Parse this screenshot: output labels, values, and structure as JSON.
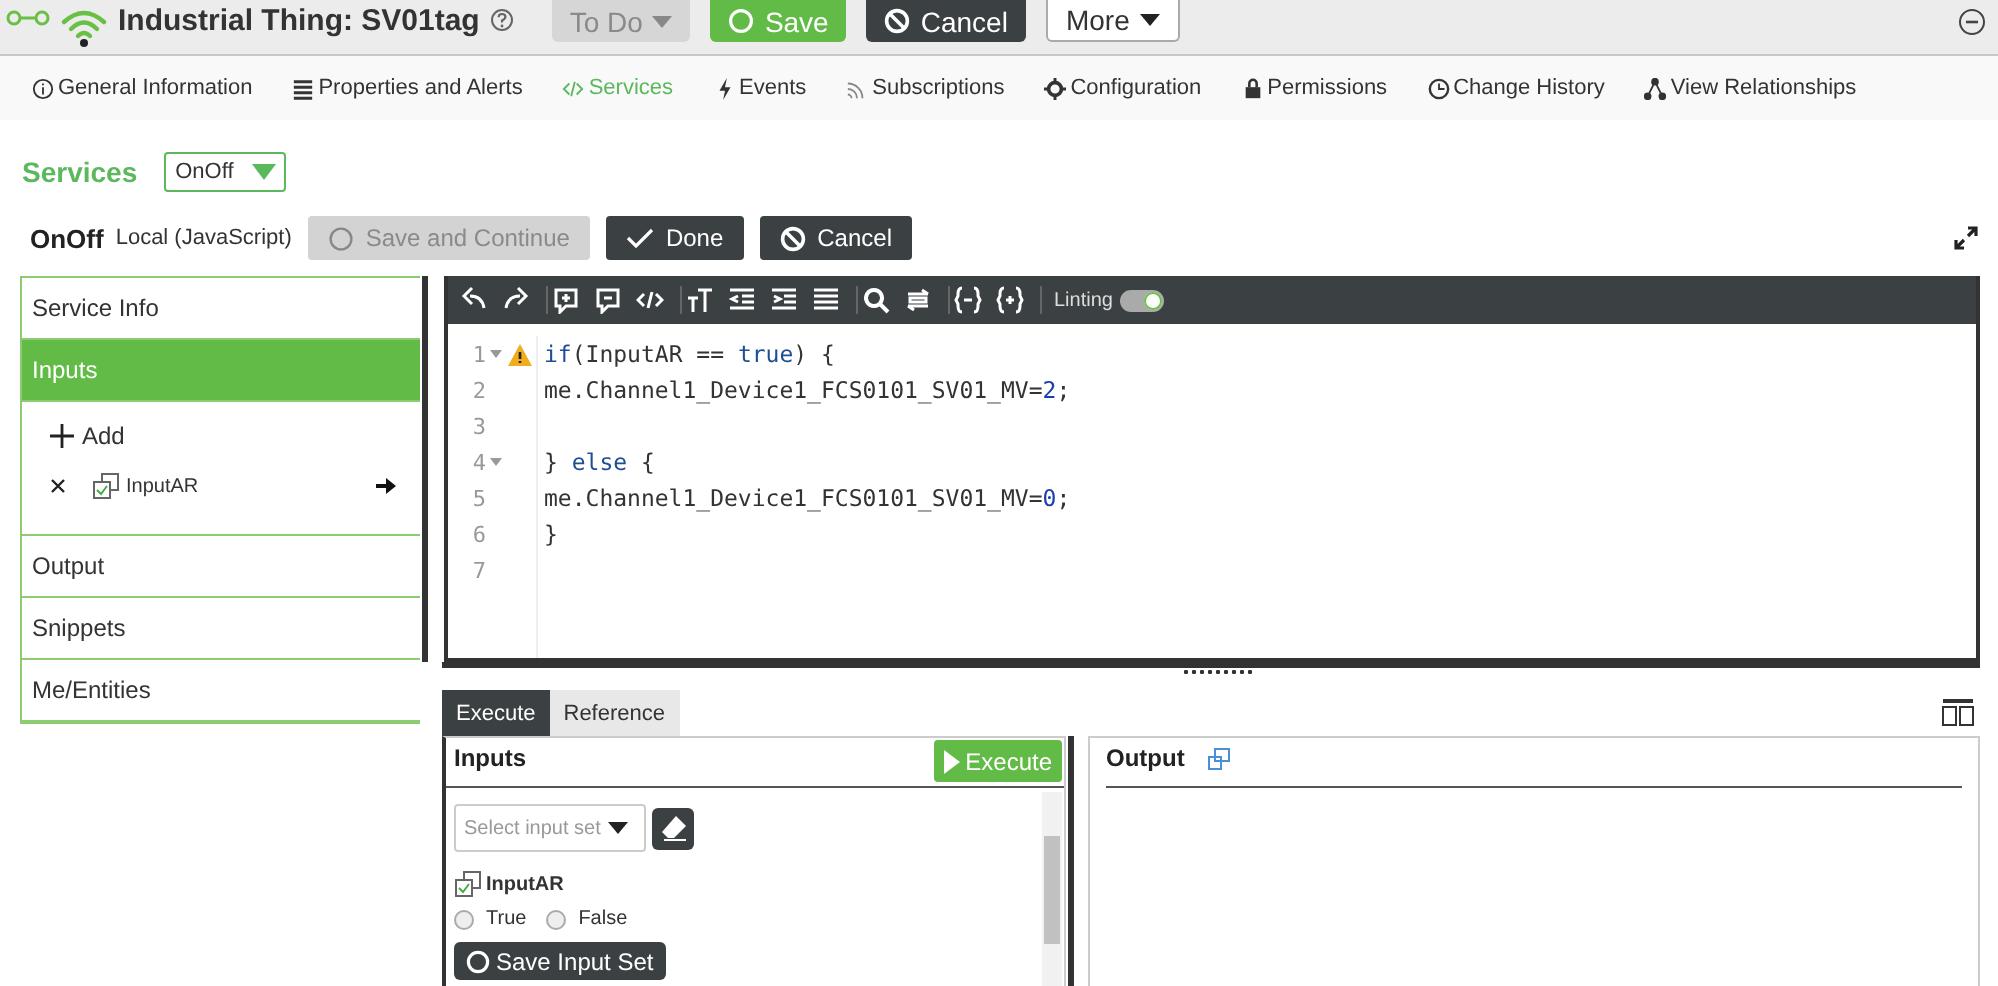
{
  "header": {
    "title": "Industrial Thing: SV01tag",
    "state_button": "To Do",
    "buttons": [
      {
        "label": "Save",
        "kind": "save"
      },
      {
        "label": "Cancel",
        "kind": "cancel"
      },
      {
        "label": "More",
        "kind": "more"
      }
    ]
  },
  "nav_tabs": [
    {
      "label": "General Information",
      "selected": false
    },
    {
      "label": "Properties and Alerts",
      "selected": false
    },
    {
      "label": "Services",
      "selected": true
    },
    {
      "label": "Events",
      "selected": false
    },
    {
      "label": "Subscriptions",
      "selected": false
    },
    {
      "label": "Configuration",
      "selected": false
    },
    {
      "label": "Permissions",
      "selected": false
    },
    {
      "label": "Change History",
      "selected": false
    },
    {
      "label": "View Relationships",
      "selected": false
    }
  ],
  "services": {
    "heading": "Services",
    "select_value": "OnOff"
  },
  "service_bar": {
    "name": "OnOff",
    "type": "Local (JavaScript)",
    "buttons": [
      {
        "label": "Save and Continue",
        "kind": "save",
        "disabled": true
      },
      {
        "label": "Done",
        "kind": "done",
        "disabled": false
      },
      {
        "label": "Cancel",
        "kind": "cancel",
        "disabled": false
      }
    ]
  },
  "sections": [
    {
      "label": "Service Info",
      "selected": false
    },
    {
      "label": "Inputs",
      "selected": true,
      "add_label": "Add",
      "parameters": [
        "InputAR"
      ]
    },
    {
      "label": "Output",
      "selected": false
    },
    {
      "label": "Snippets",
      "selected": false
    },
    {
      "label": "Me/Entities",
      "selected": false
    }
  ],
  "editor": {
    "linting": {
      "label": "Linting",
      "on": true
    },
    "lines": [
      {
        "number": "1",
        "foldable": true,
        "warning": true,
        "tokens": [
          {
            "kind": "keyword",
            "text": "if"
          },
          {
            "kind": "plain",
            "text": "(InputAR == "
          },
          {
            "kind": "keyword",
            "text": "true"
          },
          {
            "kind": "plain",
            "text": ") {"
          }
        ]
      },
      {
        "number": "2",
        "foldable": false,
        "warning": false,
        "tokens": [
          {
            "kind": "plain",
            "text": "me.Channel1_Device1_FCS0101_SV01_MV="
          },
          {
            "kind": "number",
            "text": "2"
          },
          {
            "kind": "plain",
            "text": ";"
          }
        ]
      },
      {
        "number": "3",
        "foldable": false,
        "warning": false
      },
      {
        "number": "4",
        "foldable": true,
        "warning": false,
        "tokens": [
          {
            "kind": "plain",
            "text": "} "
          },
          {
            "kind": "keyword",
            "text": "else"
          },
          {
            "kind": "plain",
            "text": " {"
          }
        ]
      },
      {
        "number": "5",
        "foldable": false,
        "warning": false,
        "tokens": [
          {
            "kind": "plain",
            "text": "me.Channel1_Device1_FCS0101_SV01_MV="
          },
          {
            "kind": "number",
            "text": "0"
          },
          {
            "kind": "plain",
            "text": ";"
          }
        ]
      },
      {
        "number": "6",
        "foldable": false,
        "warning": false,
        "tokens": [
          {
            "kind": "plain",
            "text": "}"
          }
        ]
      },
      {
        "number": "7",
        "foldable": false,
        "warning": false
      }
    ]
  },
  "bottom_tabs": [
    {
      "label": "Execute",
      "selected": true
    },
    {
      "label": "Reference",
      "selected": false
    }
  ],
  "test_inputs": {
    "title": "Inputs",
    "execute_label": "Execute",
    "input_set_placeholder": "Select input set",
    "parameter": "InputAR",
    "options": [
      {
        "label": "True",
        "selected": false
      },
      {
        "label": "False",
        "selected": false
      }
    ],
    "save_label": "Save Input Set"
  },
  "output": {
    "title": "Output"
  }
}
